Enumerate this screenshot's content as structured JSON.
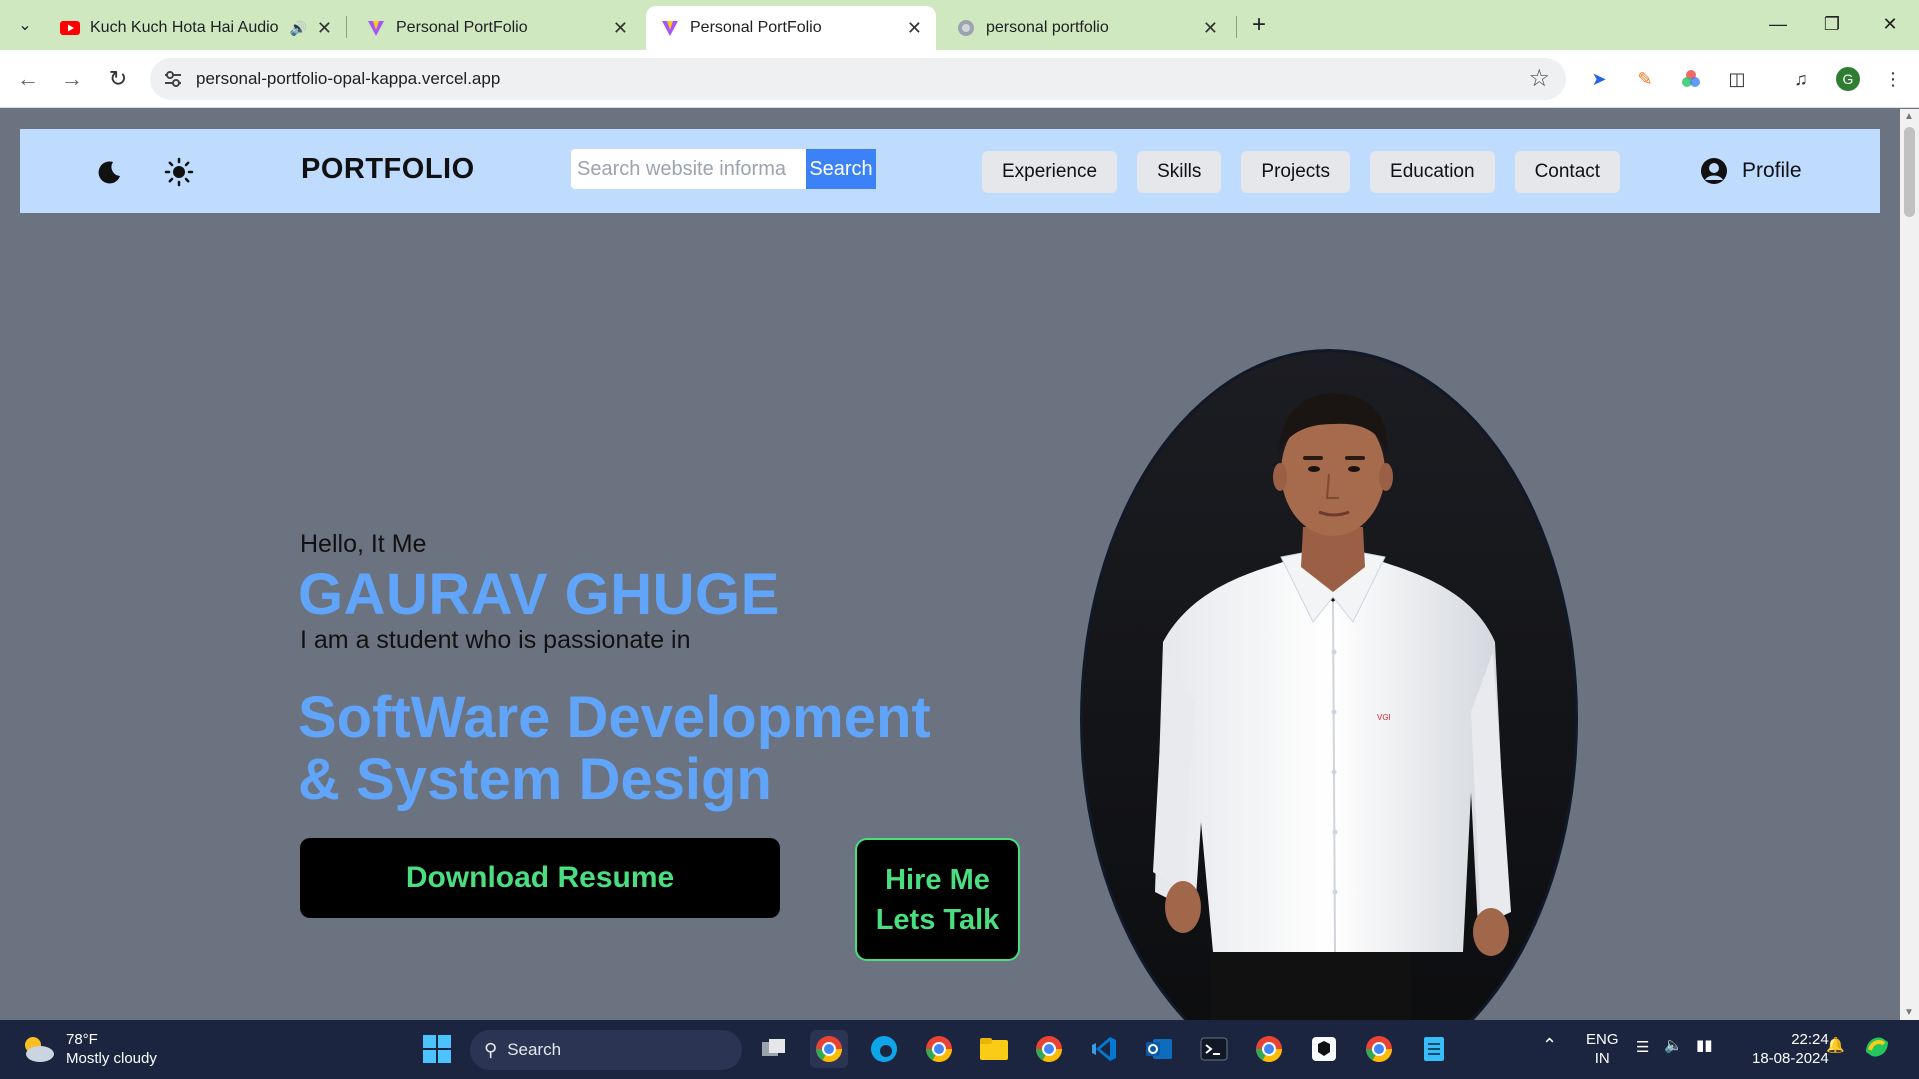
{
  "browser": {
    "tabs": [
      {
        "title": "Kuch Kuch Hota Hai Audio",
        "active": false,
        "favicon": "youtube-icon",
        "audio": true
      },
      {
        "title": "Personal PortFolio",
        "active": false,
        "favicon": "vite-icon"
      },
      {
        "title": "Personal PortFolio",
        "active": true,
        "favicon": "vite-icon"
      },
      {
        "title": "personal portfolio",
        "active": false,
        "favicon": "globe-icon"
      }
    ],
    "url": "personal-portfolio-opal-kappa.vercel.app",
    "profile_initial": "G",
    "accent_color": "#cfe8c0"
  },
  "navbar": {
    "brand": "PORTFOLIO",
    "search_placeholder": "Search website informa",
    "search_button": "Search",
    "links": [
      "Experience",
      "Skills",
      "Projects",
      "Education",
      "Contact"
    ],
    "profile_label": "Profile",
    "background": "#bfdbfe"
  },
  "hero": {
    "greeting": "Hello, It Me",
    "name": "GAURAV GHUGE",
    "intro": "I am a student who is passionate in",
    "skill_line1": "SoftWare Development",
    "skill_line2": "& System Design",
    "download_button": "Download Resume",
    "hire_line1": "Hire Me",
    "hire_line2": "Lets Talk",
    "highlight_color": "#60a5fa",
    "button_text_color": "#4ade80"
  },
  "taskbar": {
    "temperature": "78°F",
    "weather": "Mostly cloudy",
    "search_label": "Search",
    "language": "ENG",
    "region": "IN",
    "time": "22:24",
    "date": "18-08-2024"
  }
}
